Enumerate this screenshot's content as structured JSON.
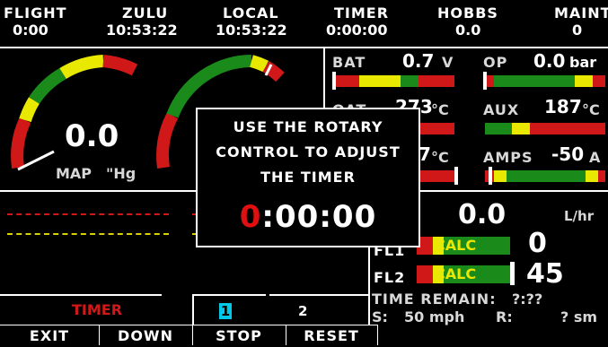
{
  "header": {
    "flight": {
      "label": "FLIGHT",
      "value": "0:00"
    },
    "zulu": {
      "label": "ZULU",
      "value": "10:53:22"
    },
    "local": {
      "label": "LOCAL",
      "value": "10:53:22"
    },
    "timer": {
      "label": "TIMER",
      "value": "0:00:00"
    },
    "hobbs": {
      "label": "HOBBS",
      "value": "0.0"
    },
    "maint": {
      "label": "MAINT",
      "value": "0"
    }
  },
  "gauges": {
    "map": {
      "value": "0.0",
      "label": "MAP",
      "unit": "\"Hg"
    }
  },
  "engine": {
    "bat": {
      "label": "BAT",
      "value": "0.7",
      "unit": "V"
    },
    "op": {
      "label": "OP",
      "value": "0.0",
      "unit": "bar"
    },
    "oat": {
      "label": "OAT",
      "value": "273",
      "unit": "°C"
    },
    "aux": {
      "label": "AUX",
      "value": "187",
      "unit": "°C"
    },
    "ct": {
      "value": "7",
      "unit": "°C"
    },
    "amps": {
      "label": "AMPS",
      "value": "-50",
      "unit": "A"
    }
  },
  "fuel": {
    "flow": {
      "value": "0.0",
      "unit": "L/hr"
    },
    "fl1": {
      "label": "FL1",
      "bar_text": "CALC",
      "value": "0"
    },
    "fl2": {
      "label": "FL2",
      "bar_text": "CALC",
      "value": "45"
    },
    "time_remain": {
      "label": "TIME REMAIN:",
      "value": "?:??"
    },
    "speed": {
      "label": "S:",
      "value": "50 mph"
    },
    "range": {
      "label": "R:",
      "value": "? sm"
    }
  },
  "timer_tabs": {
    "title": "TIMER",
    "tab1": "1",
    "tab2": "2"
  },
  "dialog": {
    "line1": "USE THE ROTARY",
    "line2": "CONTROL TO ADJUST",
    "line3": "THE TIMER",
    "time_lead": "0",
    "time_rest": ":00:00"
  },
  "softkeys": {
    "exit": "EXIT",
    "down": "DOWN",
    "stop": "STOP",
    "reset": "RESET"
  },
  "colors": {
    "green": "#1a8a1a",
    "yellow": "#e8e800",
    "red": "#d01818",
    "dialog_lead": "#e01010",
    "tab_active": "#00c8e8"
  }
}
